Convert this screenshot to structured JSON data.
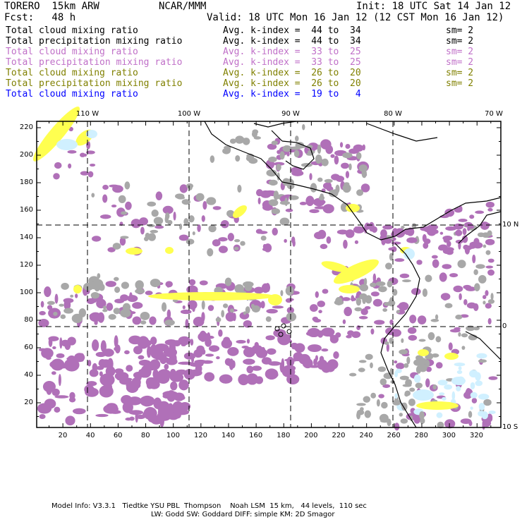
{
  "header": {
    "model": "TORERO  15km ARW",
    "org": "NCAR/MMM",
    "init": "Init: 18 UTC Sat 14 Jan 12",
    "fcst": "Fcst:   48 h",
    "valid": "Valid: 18 UTC Mon 16 Jan 12 (12 CST Mon 16 Jan 12)"
  },
  "legend": [
    {
      "field": "Total cloud mixing ratio",
      "range": "Avg. k-index =  44 to  34",
      "sm": "sm= 2",
      "color": "#000000"
    },
    {
      "field": "Total precipitation mixing ratio",
      "range": "Avg. k-index =  44 to  34",
      "sm": "sm= 2",
      "color": "#000000"
    },
    {
      "field": "Total cloud mixing ratio",
      "range": "Avg. k-index =  33 to  25",
      "sm": "sm= 2",
      "color": "#c070c8"
    },
    {
      "field": "Total precipitation mixing ratio",
      "range": "Avg. k-index =  33 to  25",
      "sm": "sm= 2",
      "color": "#c070c8"
    },
    {
      "field": "Total cloud mixing ratio",
      "range": "Avg. k-index =  26 to  20",
      "sm": "sm= 2",
      "color": "#808000"
    },
    {
      "field": "Total precipitation mixing ratio",
      "range": "Avg. k-index =  26 to  20",
      "sm": "sm= 2",
      "color": "#808000"
    },
    {
      "field": "Total cloud mixing ratio",
      "range": "Avg. k-index =  19 to   4",
      "sm": "",
      "color": "#0000ff"
    }
  ],
  "map": {
    "lon_labels": [
      "110 W",
      "100 W",
      "90 W",
      "80 W",
      "70 W"
    ],
    "lat_labels": [
      "10 N",
      "0",
      "10 S"
    ],
    "y_ticks": [
      "220",
      "200",
      "180",
      "160",
      "140",
      "120",
      "100",
      "80",
      "60",
      "40",
      "20"
    ],
    "x_ticks": [
      "20",
      "40",
      "60",
      "80",
      "100",
      "120",
      "140",
      "160",
      "180",
      "200",
      "220",
      "240",
      "260",
      "280",
      "300",
      "320"
    ],
    "fill_colors": {
      "high": "#a8a8a8",
      "mid": "#b070b8",
      "low": "#ffff50",
      "lowest": "#d0f0ff"
    }
  },
  "footer": {
    "line1": "Model Info: V3.3.1   Tiedtke YSU PBL  Thompson    Noah LSM  15 km,   44 levels,  110 sec",
    "line2": "LW: Godd SW: Goddard DIFF: simple KM: 2D Smagor"
  }
}
